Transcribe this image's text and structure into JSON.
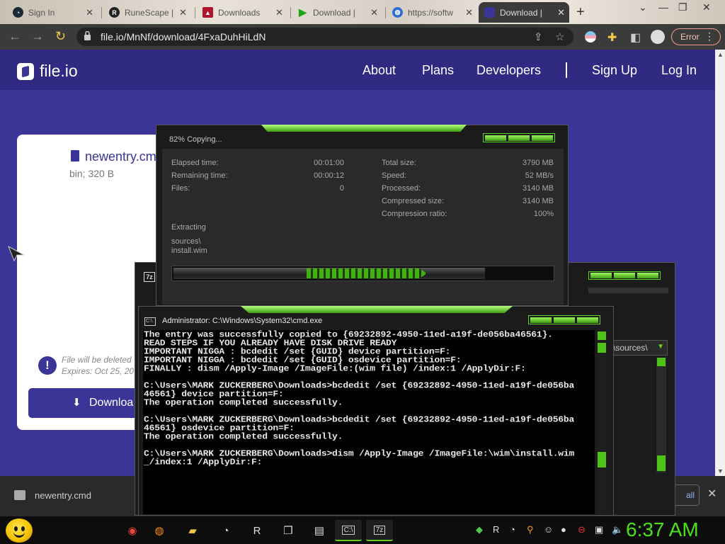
{
  "browser": {
    "tabs": [
      {
        "title": "Sign In",
        "icon": "steam-icon",
        "color": "#1b2838",
        "active": false
      },
      {
        "title": "RuneScape |",
        "icon": "runescape-icon",
        "color": "#222222",
        "active": false
      },
      {
        "title": "Downloads",
        "icon": "downloads-site-icon",
        "color": "#b0142b",
        "active": false
      },
      {
        "title": "Download |",
        "icon": "play-download-icon",
        "color": "#19a319",
        "active": false
      },
      {
        "title": "https://softw",
        "icon": "globe-icon",
        "color": "#2f6fd1",
        "active": false
      },
      {
        "title": "Download |",
        "icon": "fileio-tab-icon",
        "color": "#3b3597",
        "active": true
      }
    ],
    "new_tab_label": "+",
    "address": "file.io/MnNf/download/4FxaDuhHiLdN",
    "error_label": "Error"
  },
  "site": {
    "logo_text": "file.io",
    "nav": [
      "About",
      "Plans",
      "Developers",
      "Sign Up",
      "Log In"
    ],
    "file_name": "newentry.cmd",
    "file_meta": "bin; 320 B",
    "deleted_text": "File will be deleted",
    "expires_text": "Expires: Oct 25, 20",
    "download_label": "Downloa"
  },
  "download_shelf": {
    "file": "newentry.cmd",
    "show_all_label": "all"
  },
  "zip_progress": {
    "title": "82% Copying...",
    "progress": 0.82,
    "left_stats": [
      {
        "label": "Elapsed time:",
        "value": "00:01:00"
      },
      {
        "label": "Remaining time:",
        "value": "00:00:12"
      },
      {
        "label": "Files:",
        "value": "0"
      }
    ],
    "right_stats": [
      {
        "label": "Total size:",
        "value": "3790 MB"
      },
      {
        "label": "Speed:",
        "value": "52 MB/s"
      },
      {
        "label": "Processed:",
        "value": "3140 MB"
      },
      {
        "label": "Compressed size:",
        "value": "3140 MB"
      },
      {
        "label": "Compression ratio:",
        "value": "100%"
      }
    ],
    "status": "Extracting",
    "path1": "sources\\",
    "path2": "install.wim"
  },
  "zip_window2": {
    "icon_label": "7z",
    "path": "\\sources\\"
  },
  "cmd": {
    "title": "Administrator: C:\\Windows\\System32\\cmd.exe",
    "icon_label": "C:\\.",
    "lines": [
      "The entry was successfully copied to {69232892-4950-11ed-a19f-de056ba46561}.",
      "READ STEPS IF YOU ALREADY HAVE DISK DRIVE READY",
      "IMPORTANT NIGGA : bcdedit /set {GUID} device partition=F:",
      "IMPORTANT NIGGA : bcdedit /set {GUID} osdevice partition=F:",
      "FINALLY : dism /Apply-Image /ImageFile:(wim file) /index:1 /ApplyDir:F:",
      "",
      "C:\\Users\\MARK ZUCKERBERG\\Downloads>bcdedit /set {69232892-4950-11ed-a19f-de056ba",
      "46561} device partition=F:",
      "The operation completed successfully.",
      "",
      "C:\\Users\\MARK ZUCKERBERG\\Downloads>bcdedit /set {69232892-4950-11ed-a19f-de056ba",
      "46561} osdevice partition=F:",
      "The operation completed successfully.",
      "",
      "C:\\Users\\MARK ZUCKERBERG\\Downloads>dism /Apply-Image /ImageFile:\\wim\\install.wim",
      "_/index:1 /ApplyDir:F:"
    ]
  },
  "taskbar": {
    "apps": [
      {
        "name": "chrome-taskbar-button",
        "icon": "chrome-icon",
        "glyph": "◉",
        "active": false
      },
      {
        "name": "firefox-taskbar-button",
        "icon": "firefox-icon",
        "glyph": "◍",
        "active": false
      },
      {
        "name": "explorer-taskbar-button",
        "icon": "folder-icon",
        "glyph": "▰",
        "active": false
      },
      {
        "name": "steam-taskbar-button",
        "icon": "steam-icon",
        "glyph": "◔",
        "active": false
      },
      {
        "name": "runescape-taskbar-button",
        "icon": "runescape-icon",
        "glyph": "R",
        "active": false
      },
      {
        "name": "files-taskbar-button",
        "icon": "files-icon",
        "glyph": "❐",
        "active": false
      },
      {
        "name": "drive-taskbar-button",
        "icon": "drive-icon",
        "glyph": "▤",
        "active": false
      },
      {
        "name": "cmd-taskbar-button",
        "icon": "cmd-icon",
        "glyph": "C:\\",
        "active": true
      },
      {
        "name": "7zip-taskbar-button",
        "icon": "7zip-icon",
        "glyph": "7z",
        "active": true
      }
    ],
    "tray_icons": [
      "network-tray-icon",
      "runescape-tray-icon",
      "steam-tray-icon",
      "search-tray-icon",
      "discord-tray-icon",
      "circle-tray-icon",
      "no-entry-tray-icon",
      "monitor-tray-icon",
      "volume-tray-icon"
    ],
    "clock": "6:37 AM"
  },
  "colors": {
    "fileio_brand": "#3b3597",
    "accent_green": "#48e21a",
    "error": "#f0a08a"
  }
}
